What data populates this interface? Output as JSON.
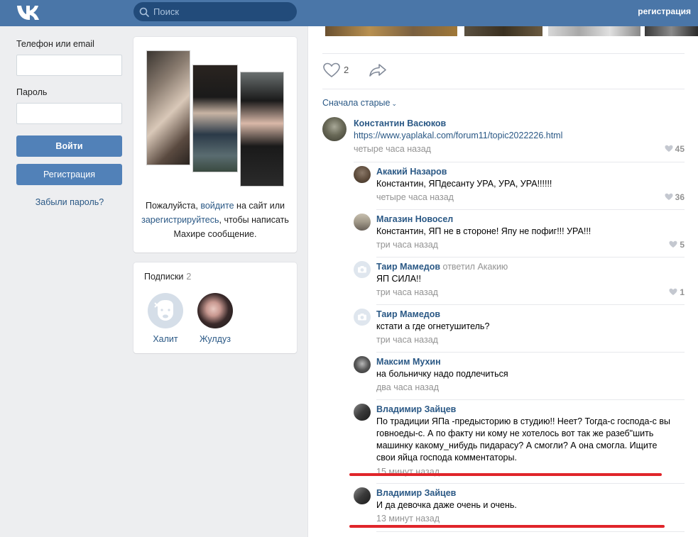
{
  "header": {
    "search_placeholder": "Поиск",
    "register_link": "регистрация"
  },
  "login": {
    "phone_label": "Телефон или email",
    "password_label": "Пароль",
    "login_button": "Войти",
    "register_button": "Регистрация",
    "forgot_link": "Забыли пароль?"
  },
  "profile": {
    "prompt_before": "Пожалуйста, ",
    "login_link": "войдите",
    "prompt_middle": " на сайт или ",
    "register_link": "зарегистрируйтесь",
    "prompt_after": ", чтобы написать Махире сообщение."
  },
  "subscriptions": {
    "title": "Подписки",
    "count": "2",
    "items": [
      {
        "name": "Халит"
      },
      {
        "name": "Жулдуз"
      }
    ]
  },
  "post": {
    "likes": "2",
    "sort_label": "Сначала старые"
  },
  "comments": [
    {
      "author": "Константин Васюков",
      "text": "https://www.yaplakal.com/forum11/topic2022226.html",
      "time": "четыре часа назад",
      "likes": "45",
      "is_link": true
    },
    {
      "author": "Акакий Назаров",
      "text": "Константин, ЯПдесанту УРА, УРА, УРА!!!!!!",
      "time": "четыре часа назад",
      "likes": "36"
    },
    {
      "author": "Магазин Новосел",
      "text": "Константин, ЯП не в стороне! Япу не пофиг!!! УРА!!!",
      "time": "три часа назад",
      "likes": "5"
    },
    {
      "author": "Таир Мамедов",
      "replied": "ответил Акакию",
      "text": "ЯП СИЛА!!",
      "time": "три часа назад",
      "likes": "1"
    },
    {
      "author": "Таир Мамедов",
      "text": "кстати а где огнетушитель?",
      "time": "три часа назад"
    },
    {
      "author": "Максим Мухин",
      "text": "на больничку надо подлечиться",
      "time": "два часа назад"
    },
    {
      "author": "Владимир Зайцев",
      "text_lines": [
        "По традиции ЯПа -предысторию в студию!! Неет? Тогда-с господа-с вы",
        "говноеды-с. А по факту ни кому не хотелось вот так же разеб\"шить",
        "машинку какому_нибудь пидарасу? А смогли? А она смогла. Ищите",
        "свои яйца господа комментаторы."
      ],
      "time": "15 минут назад"
    },
    {
      "author": "Владимир Зайцев",
      "text": "И да девочка даже очень и очень.",
      "time": "13 минут назад"
    }
  ],
  "colors": {
    "header": "#4a76a8",
    "link": "#2a5885",
    "button": "#5181b8",
    "muted": "#939393",
    "highlight": "#e0252a"
  }
}
